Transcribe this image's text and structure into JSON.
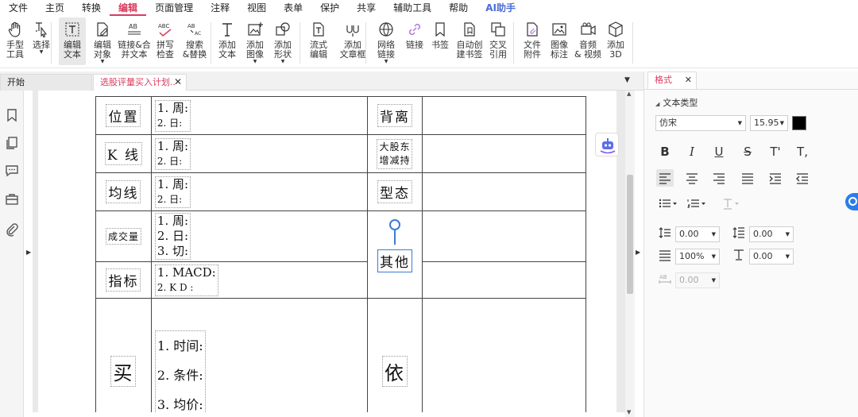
{
  "menu": {
    "items": [
      "文件",
      "主页",
      "转换",
      "编辑",
      "页面管理",
      "注释",
      "视图",
      "表单",
      "保护",
      "共享",
      "辅助工具",
      "帮助",
      "AI助手"
    ],
    "active_index": 3,
    "accent": "#d93a5c",
    "ai_color": "#4b6cd8"
  },
  "ribbon": {
    "tools": [
      {
        "icon": "hand-icon",
        "label": "手型\n工具"
      },
      {
        "icon": "cursor-icon",
        "label": "选择"
      },
      {
        "icon": "edit-text-icon",
        "label": "编辑\n文本"
      },
      {
        "icon": "edit-object-icon",
        "label": "编辑\n对象"
      },
      {
        "icon": "link-merge-icon",
        "label": "链接&合\n并文本"
      },
      {
        "icon": "spell-check-icon",
        "label": "拼写\n检查"
      },
      {
        "icon": "search-replace-icon",
        "label": "搜索\n&替换"
      },
      {
        "icon": "add-text-icon",
        "label": "添加\n文本"
      },
      {
        "icon": "add-image-icon",
        "label": "添加\n图像"
      },
      {
        "icon": "add-shape-icon",
        "label": "添加\n形状"
      },
      {
        "icon": "flow-edit-icon",
        "label": "流式\n编辑"
      },
      {
        "icon": "text-box-icon",
        "label": "添加\n文章框"
      },
      {
        "icon": "web-link-icon",
        "label": "网络\n链接"
      },
      {
        "icon": "link-icon",
        "label": "链接"
      },
      {
        "icon": "bookmark-icon",
        "label": "书签"
      },
      {
        "icon": "auto-bookmark-icon",
        "label": "自动创\n建书签"
      },
      {
        "icon": "cross-ref-icon",
        "label": "交叉\n引用"
      },
      {
        "icon": "attachment-icon",
        "label": "文件\n附件"
      },
      {
        "icon": "image-annot-icon",
        "label": "图像\n标注"
      },
      {
        "icon": "media-icon",
        "label": "音频\n& 视频"
      },
      {
        "icon": "cube-3d-icon",
        "label": "添加\n3D"
      }
    ]
  },
  "tabs": {
    "start": "开始",
    "document": "选股评量买入计划..."
  },
  "document": {
    "rows": [
      {
        "label": "位置",
        "items": [
          "1. 周:",
          "2. 日:"
        ],
        "right_label": "背离"
      },
      {
        "label": "K 线",
        "items": [
          "1. 周:",
          "2. 日:"
        ],
        "right_label_lines": [
          "大股东",
          "增减持"
        ]
      },
      {
        "label": "均线",
        "items": [
          "1. 周:",
          "2. 日:"
        ],
        "right_label": "型态"
      },
      {
        "label": "成交量",
        "items": [
          "1. 周:",
          "2. 日:",
          "3. 切:"
        ],
        "right_label": "其他"
      },
      {
        "label": "指标",
        "items": [
          "1. MACD:",
          "2. K D :"
        ]
      },
      {
        "label": "买",
        "items": [
          "1. 时间:",
          "2. 条件:",
          "3. 均价:"
        ],
        "right_label": "依"
      }
    ]
  },
  "format_panel": {
    "tab_label": "格式",
    "section_title": "文本类型",
    "font_name": "仿宋",
    "font_size": "15.95",
    "text_color": "#000000",
    "line_spacing": "0.00",
    "para_spacing": "0.00",
    "scale": "100%",
    "baseline": "0.00",
    "char_spacing": "0.00",
    "style_buttons": [
      "B",
      "I",
      "U",
      "S",
      "T'",
      "T,"
    ]
  }
}
